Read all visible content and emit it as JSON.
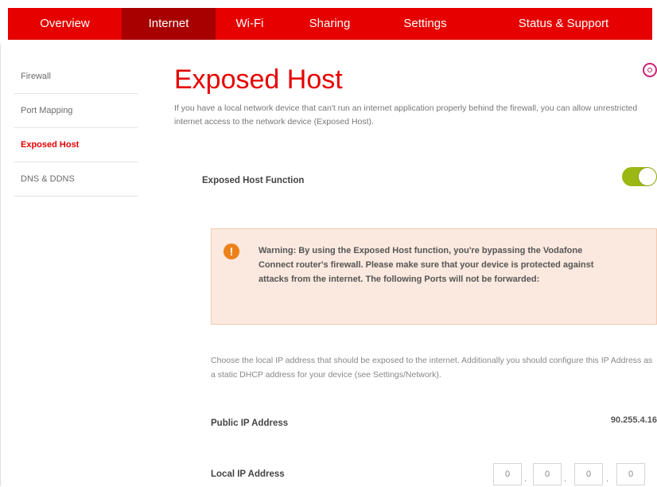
{
  "nav": {
    "items": [
      {
        "label": "Overview"
      },
      {
        "label": "Internet"
      },
      {
        "label": "Wi-Fi"
      },
      {
        "label": "Sharing"
      },
      {
        "label": "Settings"
      },
      {
        "label": "Status & Support"
      }
    ],
    "active": "Internet"
  },
  "sidebar": {
    "items": [
      {
        "label": "Firewall"
      },
      {
        "label": "Port Mapping"
      },
      {
        "label": "Exposed Host"
      },
      {
        "label": "DNS & DDNS"
      }
    ],
    "active": "Exposed Host"
  },
  "page": {
    "title": "Exposed Host",
    "intro": "If you have a local network device that can't run an internet application properly behind the firewall, you can allow unrestricted internet access to the network device (Exposed Host).",
    "function_label": "Exposed Host Function",
    "function_enabled": true
  },
  "warning": {
    "icon": "exclamation",
    "text": "Warning: By using the Exposed Host function, you're bypassing the Vodafone Connect router's firewall. Please make sure that your device is protected against attacks from the internet. The following Ports will not be forwarded:"
  },
  "choose_text": "Choose the local IP address that should be exposed to the internet. Additionally you should configure this IP Address as a static DHCP address for your device (see Settings/Network).",
  "public_ip": {
    "label": "Public IP Address",
    "value": "90.255.4.16"
  },
  "local_ip": {
    "label": "Local IP Address",
    "octets": [
      "0",
      "0",
      "0",
      "0"
    ],
    "separator": "."
  },
  "colors": {
    "brand": "#e60000",
    "nav_active": "#a80000",
    "toggle_on": "#9bb713",
    "warning_bg": "#fbe9df",
    "warning_icon": "#ec8119"
  }
}
